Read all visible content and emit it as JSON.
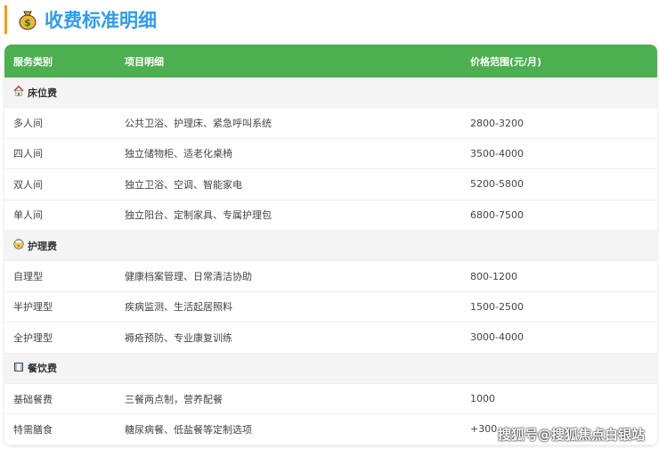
{
  "title": "收费标准明细",
  "headers": [
    "服务类别",
    "项目明细",
    "价格范围(元/月)"
  ],
  "sections": [
    {
      "name": "床位费",
      "icon": "house-icon",
      "rows": [
        {
          "type": "多人间",
          "detail": "公共卫浴、护理床、紧急呼叫系统",
          "price": "2800-3200"
        },
        {
          "type": "四人间",
          "detail": "独立储物柜、适老化桌椅",
          "price": "3500-4000"
        },
        {
          "type": "双人间",
          "detail": "独立卫浴、空调、智能家电",
          "price": "5200-5800"
        },
        {
          "type": "单人间",
          "detail": "独立阳台、定制家具、专属护理包",
          "price": "6800-7500"
        }
      ]
    },
    {
      "name": "护理费",
      "icon": "nurse-face-icon",
      "rows": [
        {
          "type": "自理型",
          "detail": "健康档案管理、日常清洁协助",
          "price": "800-1200"
        },
        {
          "type": "半护理型",
          "detail": "疾病监测、生活起居照料",
          "price": "1500-2500"
        },
        {
          "type": "全护理型",
          "detail": "褥疮预防、专业康复训练",
          "price": "3000-4000"
        }
      ]
    },
    {
      "name": "餐饮费",
      "icon": "meal-icon",
      "rows": [
        {
          "type": "基础餐费",
          "detail": "三餐两点制，营养配餐",
          "price": "1000"
        },
        {
          "type": "特需膳食",
          "detail": "糖尿病餐、低盐餐等定制选项",
          "price": "+300"
        }
      ]
    }
  ],
  "watermark": "搜狐号@搜狐焦点白银站"
}
